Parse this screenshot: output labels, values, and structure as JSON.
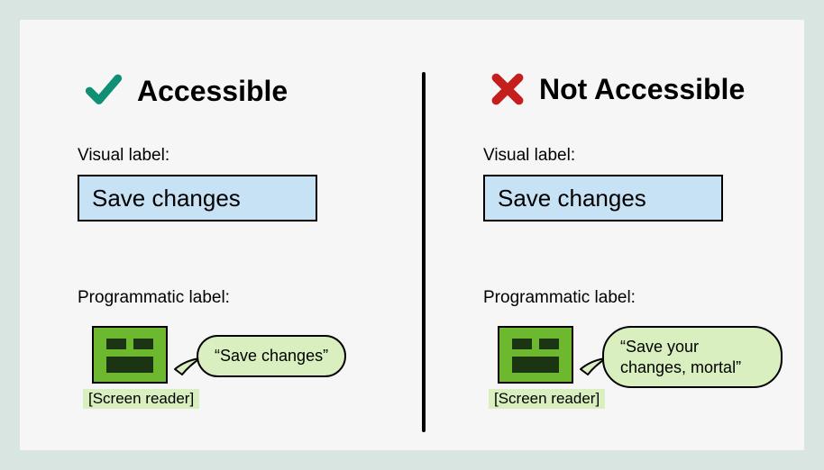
{
  "left": {
    "title": "Accessible",
    "visual_label": "Visual label:",
    "button_text": "Save changes",
    "prog_label": "Programmatic label:",
    "speech": "“Save changes”",
    "sr_caption": "[Screen reader]"
  },
  "right": {
    "title": "Not Accessible",
    "visual_label": "Visual label:",
    "button_text": "Save changes",
    "prog_label": "Programmatic label:",
    "speech": "“Save your changes, mortal”",
    "sr_caption": "[Screen reader]"
  },
  "colors": {
    "check": "#0f8f74",
    "cross": "#c41f1c",
    "button_bg": "#c8e2f5",
    "bubble_bg": "#d9efc0",
    "sr_bg": "#6db82e"
  }
}
